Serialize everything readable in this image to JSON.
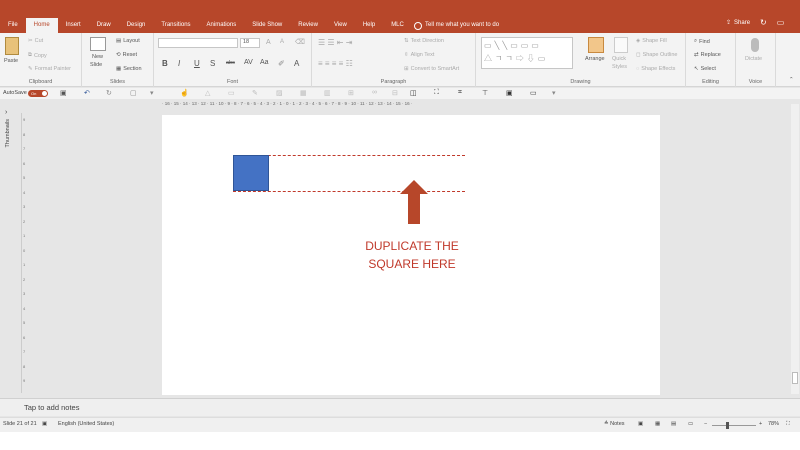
{
  "tabs": [
    "File",
    "Home",
    "Insert",
    "Draw",
    "Design",
    "Transitions",
    "Animations",
    "Slide Show",
    "Review",
    "View",
    "Help",
    "MLC"
  ],
  "active_tab": "Home",
  "tell_me": "Tell me what you want to do",
  "share": "Share",
  "clipboard": {
    "paste": "Paste",
    "cut": "Cut",
    "copy": "Copy",
    "format_painter": "Format Painter",
    "label": "Clipboard"
  },
  "slides": {
    "new_slide": "New",
    "new_slide2": "Slide",
    "layout": "Layout",
    "reset": "Reset",
    "section": "Section",
    "label": "Slides"
  },
  "font": {
    "size": "18",
    "bold": "B",
    "italic": "I",
    "underline": "U",
    "strike": "S",
    "abc": "abc",
    "aa": "Aa",
    "label": "Font"
  },
  "paragraph": {
    "text_direction": "Text Direction",
    "align_text": "Align Text",
    "smartart": "Convert to SmartArt",
    "label": "Paragraph"
  },
  "drawing": {
    "arrange": "Arrange",
    "quick_styles": "Quick",
    "quick_styles2": "Styles",
    "shape_fill": "Shape Fill",
    "shape_outline": "Shape Outline",
    "shape_effects": "Shape Effects",
    "label": "Drawing"
  },
  "editing": {
    "find": "Find",
    "replace": "Replace",
    "select": "Select",
    "label": "Editing"
  },
  "voice": {
    "dictate": "Dictate",
    "label": "Voice"
  },
  "qat": {
    "autosave": "AutoSave",
    "toggle": "On"
  },
  "thumbnails": "Thumbnails",
  "ruler": "· 16 · 15 · 14 · 13 · 12 · 11 · 10 · 9 · 8 · 7 · 6 · 5 · 4 · 3 · 2 · 1 · 0 · 1 · 2 · 3 · 4 · 5 · 6 · 7 · 8 · 9 · 10 · 11 · 12 · 13 · 14 · 15 · 16 ·",
  "vruler": [
    "9",
    "8",
    "7",
    "6",
    "5",
    "4",
    "3",
    "2",
    "1",
    "0",
    "1",
    "2",
    "3",
    "4",
    "5",
    "6",
    "7",
    "8",
    "9"
  ],
  "slide": {
    "caption_line1": "DUPLICATE THE",
    "caption_line2": "SQUARE HERE"
  },
  "notes": "Tap to add notes",
  "status": {
    "slide_count": "Slide 21 of 21",
    "language": "English (United States)",
    "notes_btn": "Notes",
    "zoom": "78%"
  },
  "colors": {
    "accent": "#b7472a",
    "square": "#4472c4",
    "annotation": "#c0392b"
  }
}
